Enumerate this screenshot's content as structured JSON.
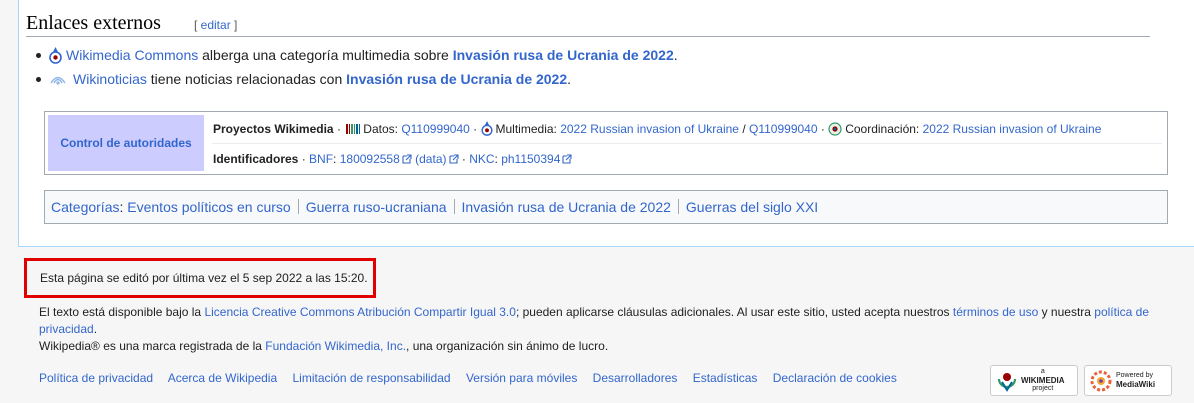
{
  "section": {
    "title": "Enlaces externos",
    "edit_label": "editar"
  },
  "external_links": [
    {
      "link": "Wikimedia Commons",
      "text": " alberga una categoría multimedia sobre ",
      "target": "Invasión rusa de Ucrania de 2022",
      "tail": "."
    },
    {
      "link": "Wikinoticias",
      "text": " tiene noticias relacionadas con ",
      "target": "Invasión rusa de Ucrania de 2022",
      "tail": "."
    }
  ],
  "authority": {
    "label": "Control de autoridades",
    "projects_label": "Proyectos Wikimedia",
    "datos_label": "Datos: ",
    "datos_value": "Q110999040",
    "multimedia_label": "Multimedia: ",
    "multimedia_value": "2022 Russian invasion of Ukraine",
    "multimedia_slash": " / ",
    "multimedia_value2": "Q110999040",
    "coord_label": "Coordinación: ",
    "coord_value": "2022 Russian invasion of Ukraine",
    "identifiers_label": "Identificadores",
    "bnf_label": "BNF",
    "bnf_value": "180092558",
    "bnf_data": "(data)",
    "nkc_label": "NKC",
    "nkc_value": "ph1150394"
  },
  "categories": {
    "label": "Categorías",
    "items": [
      "Eventos políticos en curso",
      "Guerra ruso-ucraniana",
      "Invasión rusa de Ucrania de 2022",
      "Guerras del siglo XXI"
    ]
  },
  "footer": {
    "last_modified": "Esta página se editó por última vez el 5 sep 2022 a las 15:20.",
    "license_pre": "El texto está disponible bajo la ",
    "license_link": "Licencia Creative Commons Atribución Compartir Igual 3.0",
    "license_mid": "; pueden aplicarse cláusulas adicionales. Al usar este sitio, usted acepta nuestros ",
    "terms_link": "términos de uso",
    "license_and": " y nuestra ",
    "privacy_link": "política de privacidad",
    "license_end": ".",
    "trademark_pre": "Wikipedia® es una marca registrada de la ",
    "trademark_link": "Fundación Wikimedia, Inc.",
    "trademark_post": ", una organización sin ánimo de lucro.",
    "links": [
      "Política de privacidad",
      "Acerca de Wikipedia",
      "Limitación de responsabilidad",
      "Versión para móviles",
      "Desarrolladores",
      "Estadísticas",
      "Declaración de cookies"
    ],
    "wikimedia_badge": {
      "top": "a",
      "name": "WIKIMEDIA",
      "sub": "project"
    },
    "mediawiki_badge": {
      "top": "Powered by",
      "name": "MediaWiki"
    }
  }
}
